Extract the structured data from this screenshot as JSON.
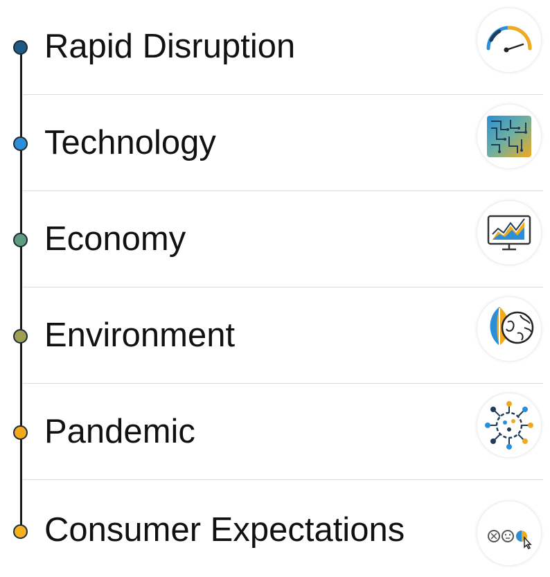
{
  "timeline": {
    "items": [
      {
        "label": "Rapid Disruption",
        "dot_color": "#1f5a86",
        "icon": "speedometer-icon"
      },
      {
        "label": "Technology",
        "dot_color": "#2a8fd6",
        "icon": "circuit-board-icon"
      },
      {
        "label": "Economy",
        "dot_color": "#5f9b7e",
        "icon": "monitor-chart-icon"
      },
      {
        "label": "Environment",
        "dot_color": "#9fa04f",
        "icon": "leaf-globe-icon"
      },
      {
        "label": "Pandemic",
        "dot_color": "#f0aa1e",
        "icon": "virus-icon"
      },
      {
        "label": "Consumer Expectations",
        "dot_color": "#f4b01e",
        "icon": "smiley-ratings-icon"
      }
    ]
  },
  "colors": {
    "line": "#1a1a1a",
    "divider": "#dcdcdc",
    "accent_blue": "#2a8fd6",
    "accent_gold": "#f0aa1e",
    "accent_navy": "#1f3b5a"
  }
}
